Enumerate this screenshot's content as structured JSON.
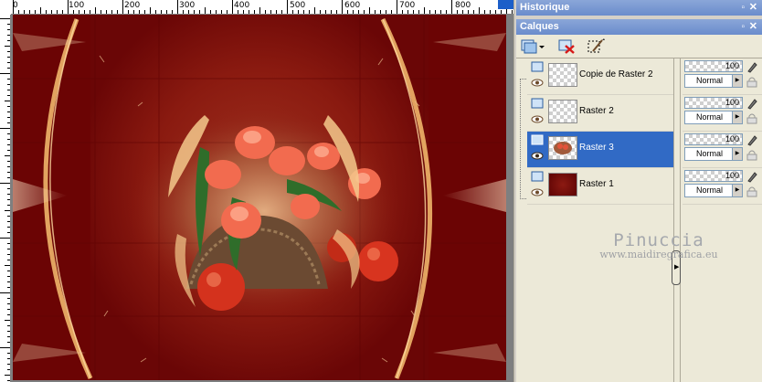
{
  "ruler": {
    "top_labels": [
      "0",
      "100",
      "200",
      "300",
      "400",
      "500",
      "600",
      "700",
      "800"
    ]
  },
  "panels": {
    "history": {
      "title": "Historique",
      "pin_icon": "pin-icon",
      "close_icon": "close-icon"
    },
    "layers": {
      "title": "Calques",
      "pin_icon": "pin-icon",
      "close_icon": "close-icon"
    }
  },
  "toolbar": {
    "buttons": [
      "new-layer-icon",
      "delete-layer-icon",
      "edit-selection-icon"
    ]
  },
  "layers": [
    {
      "name": "Copie de Raster 2",
      "opacity": "100",
      "blend": "Normal",
      "thumb": "transparent",
      "selected": false
    },
    {
      "name": "Raster 2",
      "opacity": "100",
      "blend": "Normal",
      "thumb": "transparent",
      "selected": false
    },
    {
      "name": "Raster 3",
      "opacity": "100",
      "blend": "Normal",
      "thumb": "flowers",
      "selected": true
    },
    {
      "name": "Raster 1",
      "opacity": "100",
      "blend": "Normal",
      "thumb": "dark-red",
      "selected": false
    }
  ],
  "watermark": {
    "name": "Pinuccia",
    "url": "www.maidiregrafica.eu"
  },
  "colors": {
    "selection": "#316ac5",
    "canvas_base": "#6b0404",
    "accent_gold": "#e8b36a"
  }
}
